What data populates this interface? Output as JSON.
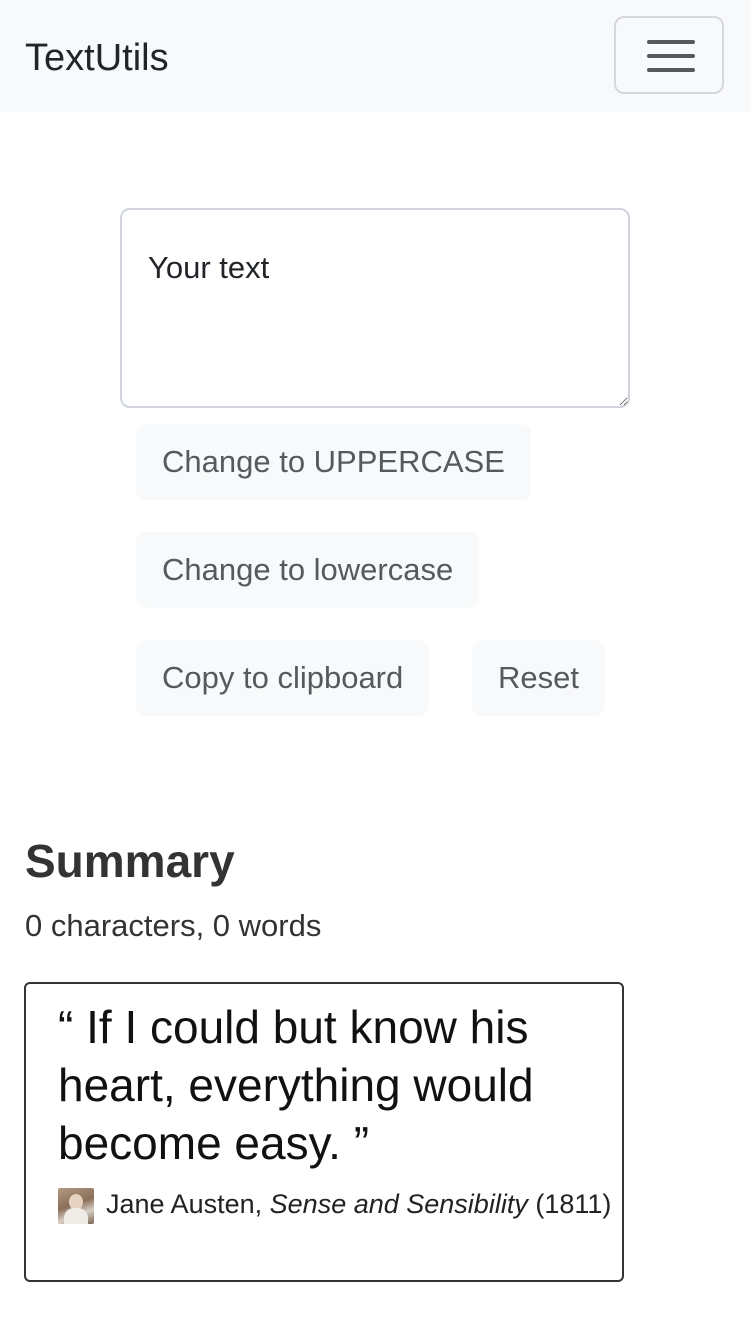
{
  "navbar": {
    "brand": "TextUtils",
    "menu_icon": "hamburger-menu-icon"
  },
  "editor": {
    "placeholder": "Your text",
    "value": ""
  },
  "buttons": {
    "uppercase": "Change to UPPERCASE",
    "lowercase": "Change to lowercase",
    "copy": "Copy to clipboard",
    "reset": "Reset"
  },
  "summary": {
    "title": "Summary",
    "text": "0 characters, 0 words"
  },
  "quote": {
    "open_mark": "“",
    "text": "If I could but know his heart, everything would become easy.",
    "close_mark": "”",
    "author": "Jane Austen",
    "separator": ",",
    "work": "Sense and Sensibility",
    "year": "(1811)"
  },
  "colors": {
    "navbar_bg": "#f8f9fa",
    "button_bg": "#f8f9fa",
    "button_text": "#555a5f"
  }
}
